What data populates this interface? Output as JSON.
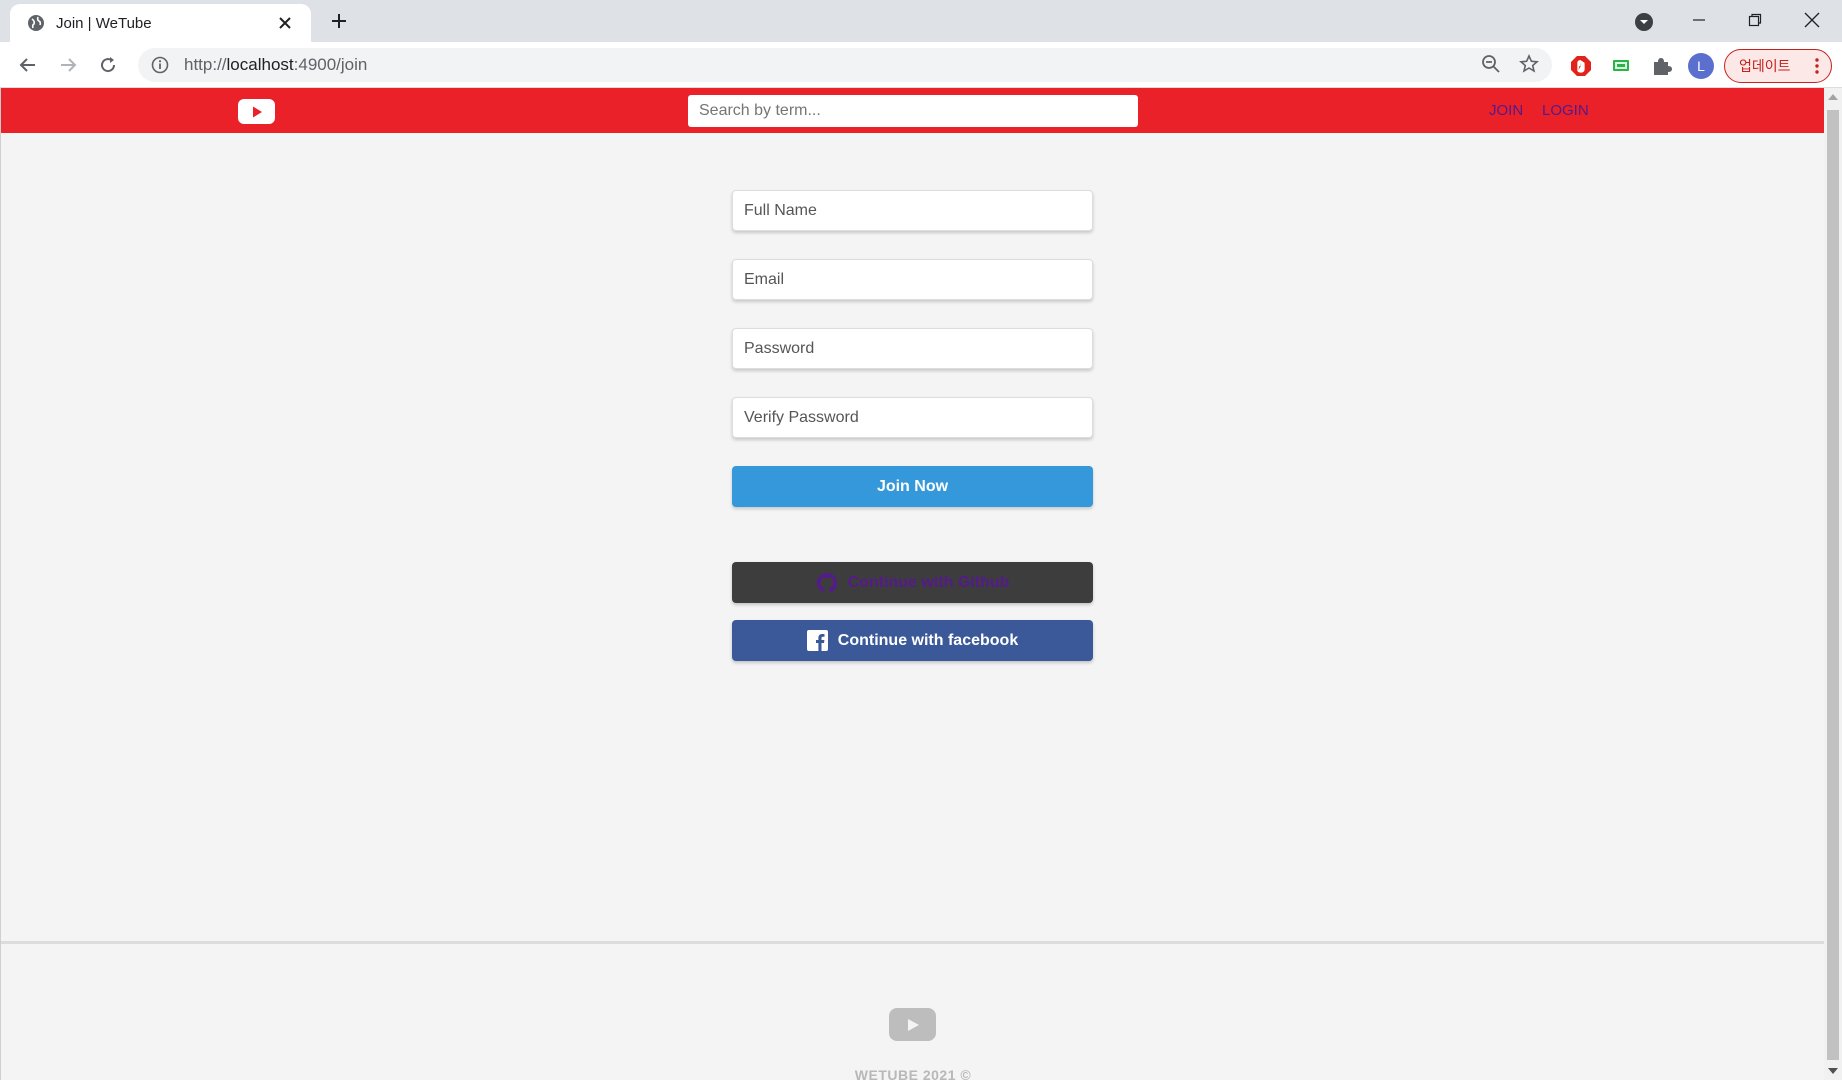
{
  "browser": {
    "tab_title": "Join | WeTube",
    "url_prefix": "http://",
    "url_host": "localhost",
    "url_path": ":4900/join",
    "avatar_letter": "L",
    "update_label": "업데이트"
  },
  "header": {
    "search_placeholder": "Search by term...",
    "links": {
      "join": "Join",
      "login": "Login"
    }
  },
  "form": {
    "full_name_placeholder": "Full Name",
    "email_placeholder": "Email",
    "password_placeholder": "Password",
    "verify_password_placeholder": "Verify Password",
    "submit_label": "Join Now"
  },
  "social": {
    "github_label": "Continue with Github",
    "facebook_label": "Continue with facebook"
  },
  "footer": {
    "text": "WETUBE 2021 ©"
  },
  "colors": {
    "header_red": "#ea2128",
    "join_blue": "#3498db",
    "github_dark": "#3d3d3d",
    "facebook_blue": "#3b5998",
    "link_visited": "#551a8b"
  }
}
